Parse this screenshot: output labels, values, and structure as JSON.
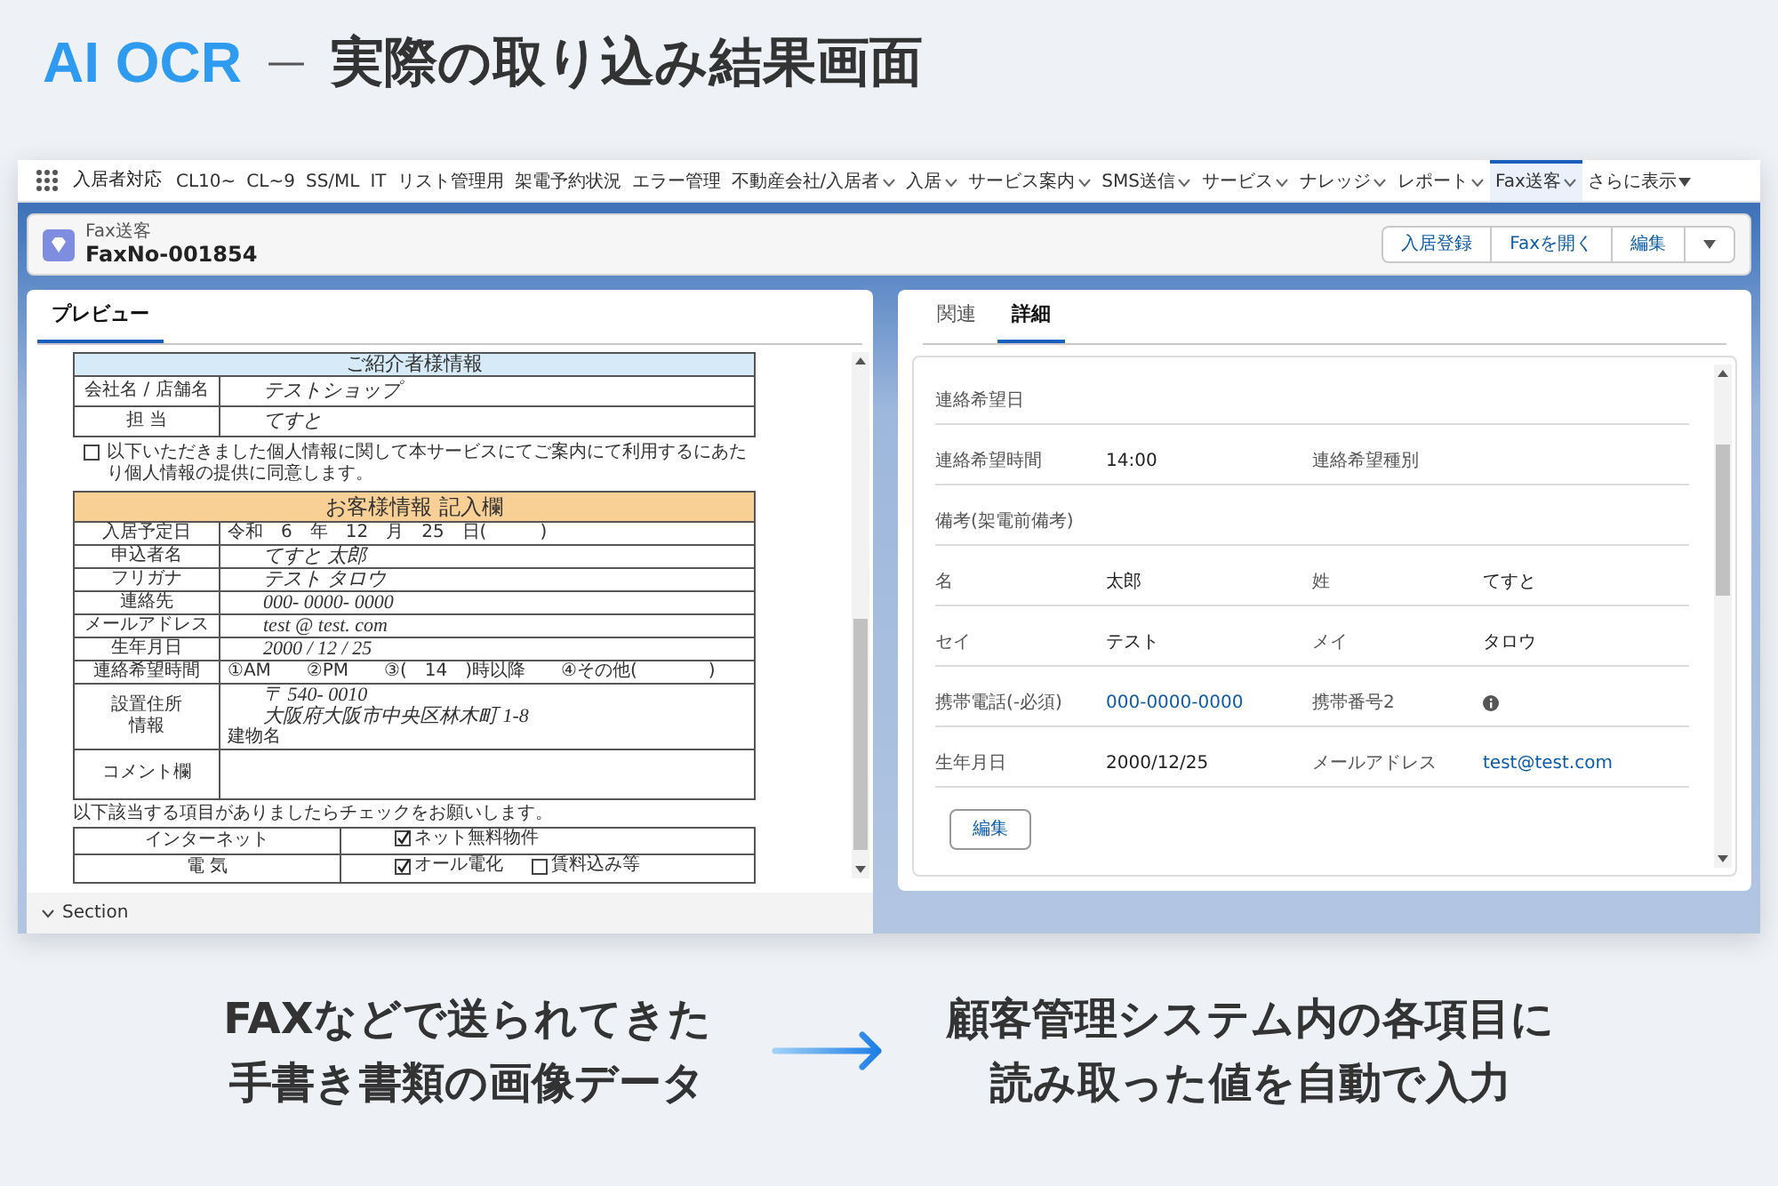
{
  "headline": {
    "brand": "AI OCR",
    "dash": "—",
    "title": "実際の取り込み結果画面"
  },
  "app": {
    "app_name": "入居者対応",
    "nav": [
      {
        "label": "CL10~",
        "selected": false
      },
      {
        "label": "CL~9",
        "selected": false
      },
      {
        "label": "SS/ML",
        "selected": false
      },
      {
        "label": "IT",
        "selected": false
      },
      {
        "label": "リスト管理用",
        "selected": false
      },
      {
        "label": "架電予約状況",
        "selected": false
      },
      {
        "label": "エラー管理",
        "selected": false
      },
      {
        "label": "不動産会社/入居者",
        "dropdown": true,
        "selected": false
      },
      {
        "label": "入居",
        "dropdown": true,
        "selected": false
      },
      {
        "label": "サービス案内",
        "dropdown": true,
        "selected": false
      },
      {
        "label": "SMS送信",
        "dropdown": true,
        "selected": false
      },
      {
        "label": "サービス",
        "dropdown": true,
        "selected": false
      },
      {
        "label": "ナレッジ",
        "dropdown": true,
        "selected": false
      },
      {
        "label": "レポート",
        "dropdown": true,
        "selected": false
      },
      {
        "label": "Fax送客",
        "dropdown": true,
        "selected": true
      },
      {
        "label": "さらに表示",
        "overflow": true,
        "selected": false
      }
    ],
    "record": {
      "object": "Fax送客",
      "name": "FaxNo-001854",
      "actions": [
        "入居登録",
        "Faxを開く",
        "編集"
      ]
    },
    "preview": {
      "tabs": [
        {
          "label": "プレビュー",
          "selected": true
        }
      ],
      "fax": [
        {
          "kind": "table",
          "header": "ご紹介者様情報",
          "color": "#d6eaf7",
          "rows": [
            {
              "label": [
                "会社名 / 店舗名"
              ],
              "lines": [
                {
                  "text": "テストショップ",
                  "hand": true
                }
              ]
            },
            {
              "label": [
                "担 当"
              ],
              "lines": [
                {
                  "text": "てすと",
                  "hand": true
                }
              ]
            }
          ]
        },
        {
          "kind": "consent",
          "checked": false,
          "text": "以下いただきました個人情報に関して本サービスにてご案内にて利用するにあたり個人情報の提供に同意します。"
        },
        {
          "kind": "table",
          "header": "お客様情報 記入欄",
          "color": "#f8cf94",
          "rows": [
            {
              "label": [
                "入居予定日"
              ],
              "lines": [
                {
                  "text": "令和　6　年　12　月　25　日(　　　)",
                  "hand": false
                }
              ]
            },
            {
              "label": [
                "申込者名"
              ],
              "lines": [
                {
                  "text": "てすと 太郎",
                  "hand": true
                }
              ]
            },
            {
              "label": [
                "フリガナ"
              ],
              "lines": [
                {
                  "text": "テスト タロウ",
                  "hand": true
                }
              ]
            },
            {
              "label": [
                "連絡先"
              ],
              "lines": [
                {
                  "text": "000- 0000- 0000",
                  "hand": true
                }
              ]
            },
            {
              "label": [
                "メールアドレス"
              ],
              "lines": [
                {
                  "text": "test @ test. com",
                  "hand": true
                }
              ]
            },
            {
              "label": [
                "生年月日"
              ],
              "lines": [
                {
                  "text": "2000 / 12 / 25",
                  "hand": true
                }
              ]
            },
            {
              "label": [
                "連絡希望時間"
              ],
              "lines": [
                {
                  "text": "①AM　　②PM　　③(　14　)時以降　　④その他(　　　　)",
                  "hand": false
                }
              ]
            },
            {
              "label": [
                "設置住所",
                "情報"
              ],
              "lines": [
                {
                  "text": "〒 540- 0010",
                  "hand": true
                },
                {
                  "text": "大阪府大阪市中央区林木町 1-8",
                  "hand": true
                },
                {
                  "text": "建物名",
                  "hand": false
                }
              ]
            },
            {
              "label": [
                "コメント欄"
              ]
            }
          ]
        },
        {
          "kind": "note",
          "text": "以下該当する項目がありましたらチェックをお願いします。"
        },
        {
          "kind": "checklist",
          "rows": [
            {
              "label": "インターネット",
              "options": [
                {
                  "text": "ネット無料物件",
                  "checked": true
                }
              ]
            },
            {
              "label": "電 気",
              "options": [
                {
                  "text": "オール電化",
                  "checked": true
                },
                {
                  "text": "賃料込み等",
                  "checked": false
                }
              ]
            }
          ]
        }
      ],
      "section": "Section"
    },
    "details": {
      "tabs": [
        {
          "label": "関連",
          "selected": false
        },
        {
          "label": "詳細",
          "selected": true
        }
      ],
      "rows": [
        [
          {
            "label": "連絡希望日"
          }
        ],
        [
          {
            "label": "連絡希望時間",
            "value": "14:00"
          },
          {
            "label": "連絡希望種別"
          }
        ],
        [
          {
            "label": "備考(架電前備考)"
          }
        ],
        [
          {
            "label": "名",
            "value": "太郎"
          },
          {
            "label": "姓",
            "value": "てすと"
          }
        ],
        [
          {
            "label": "セイ",
            "value": "テスト"
          },
          {
            "label": "メイ",
            "value": "タロウ"
          }
        ],
        [
          {
            "label": "携帯電話(-必須)",
            "value": "000-0000-0000",
            "link": true
          },
          {
            "label": "携帯番号2",
            "info": true
          }
        ],
        [
          {
            "label": "生年月日",
            "value": "2000/12/25"
          },
          {
            "label": "メールアドレス",
            "value": "test@test.com",
            "link": true
          }
        ]
      ],
      "edit_button": "編集"
    }
  },
  "captions": {
    "left": [
      "FAXなどで送られてきた",
      "手書き書類の画像データ"
    ],
    "right": [
      "顧客管理システム内の各項目に",
      "読み取った値を自動で入力"
    ]
  }
}
